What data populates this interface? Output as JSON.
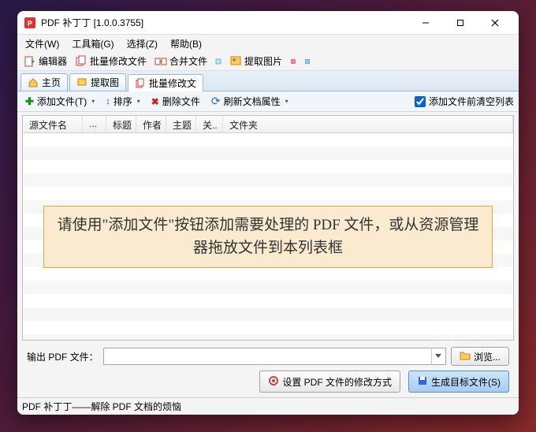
{
  "title": "PDF 补丁丁 [1.0.0.3755]",
  "menubar": {
    "file": "文件(W)",
    "tools": "工具箱(G)",
    "select": "选择(Z)",
    "help": "帮助(B)"
  },
  "toolbar1": {
    "editor": "编辑器",
    "batch_modify": "批量修改文件",
    "merge": "合并文件",
    "extract_img": "提取图片"
  },
  "tabs": {
    "home": "主页",
    "extract": "提取图",
    "batch": "批量修改文"
  },
  "toolbar2": {
    "add_files": "添加文件(T)",
    "sort": "排序",
    "delete": "删除文件",
    "refresh": "刷新文档属性",
    "clear_checkbox": "添加文件前清空列表"
  },
  "columns": {
    "c0": "源文件名",
    "c1": "...",
    "c2": "标题",
    "c3": "作者",
    "c4": "主题",
    "c5": "关..",
    "c6": "文件夹"
  },
  "hint": "请使用\"添加文件\"按钮添加需要处理的 PDF 文件，或从资源管理器拖放文件到本列表框",
  "output": {
    "label": "输出 PDF 文件：",
    "browse": "浏览..."
  },
  "actions": {
    "settings": "设置 PDF 文件的修改方式",
    "generate": "生成目标文件(S)"
  },
  "status": "PDF 补丁丁——解除 PDF 文档的烦恼",
  "watermark": {
    "cn": "异次元",
    "en": "IPLAYSOFT.COM"
  }
}
